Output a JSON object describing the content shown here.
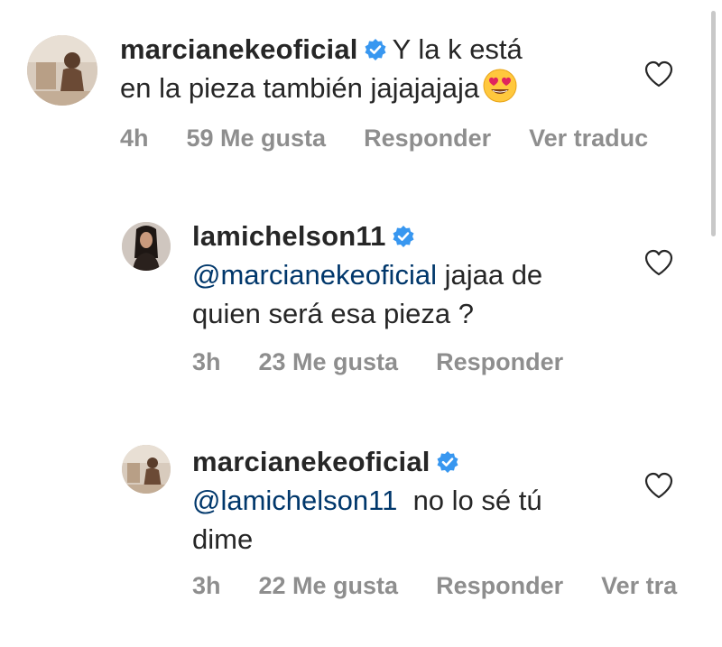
{
  "comments": [
    {
      "username": "marcianekeoficial",
      "text_line1": "Y la k está",
      "text_line2": "en la pieza también jajajajaja",
      "emoji": "heart-eyes",
      "time": "4h",
      "likes": "59 Me gusta",
      "reply": "Responder",
      "translate": "Ver traduc"
    },
    {
      "username": "lamichelson11",
      "mention": "@marcianekeoficial",
      "text_line1": " jajaa de",
      "text_line2": "quien será esa pieza ?",
      "time": "3h",
      "likes": "23 Me gusta",
      "reply": "Responder"
    },
    {
      "username": "marcianekeoficial",
      "mention": "@lamichelson11",
      "text_line1": "  no lo sé tú",
      "text_line2": "dime",
      "time": "3h",
      "likes": "22 Me gusta",
      "reply": "Responder",
      "translate": "Ver tra"
    }
  ],
  "colors": {
    "text": "#262626",
    "meta": "#8e8e8e",
    "mention": "#00376b",
    "verified": "#3897f0"
  }
}
